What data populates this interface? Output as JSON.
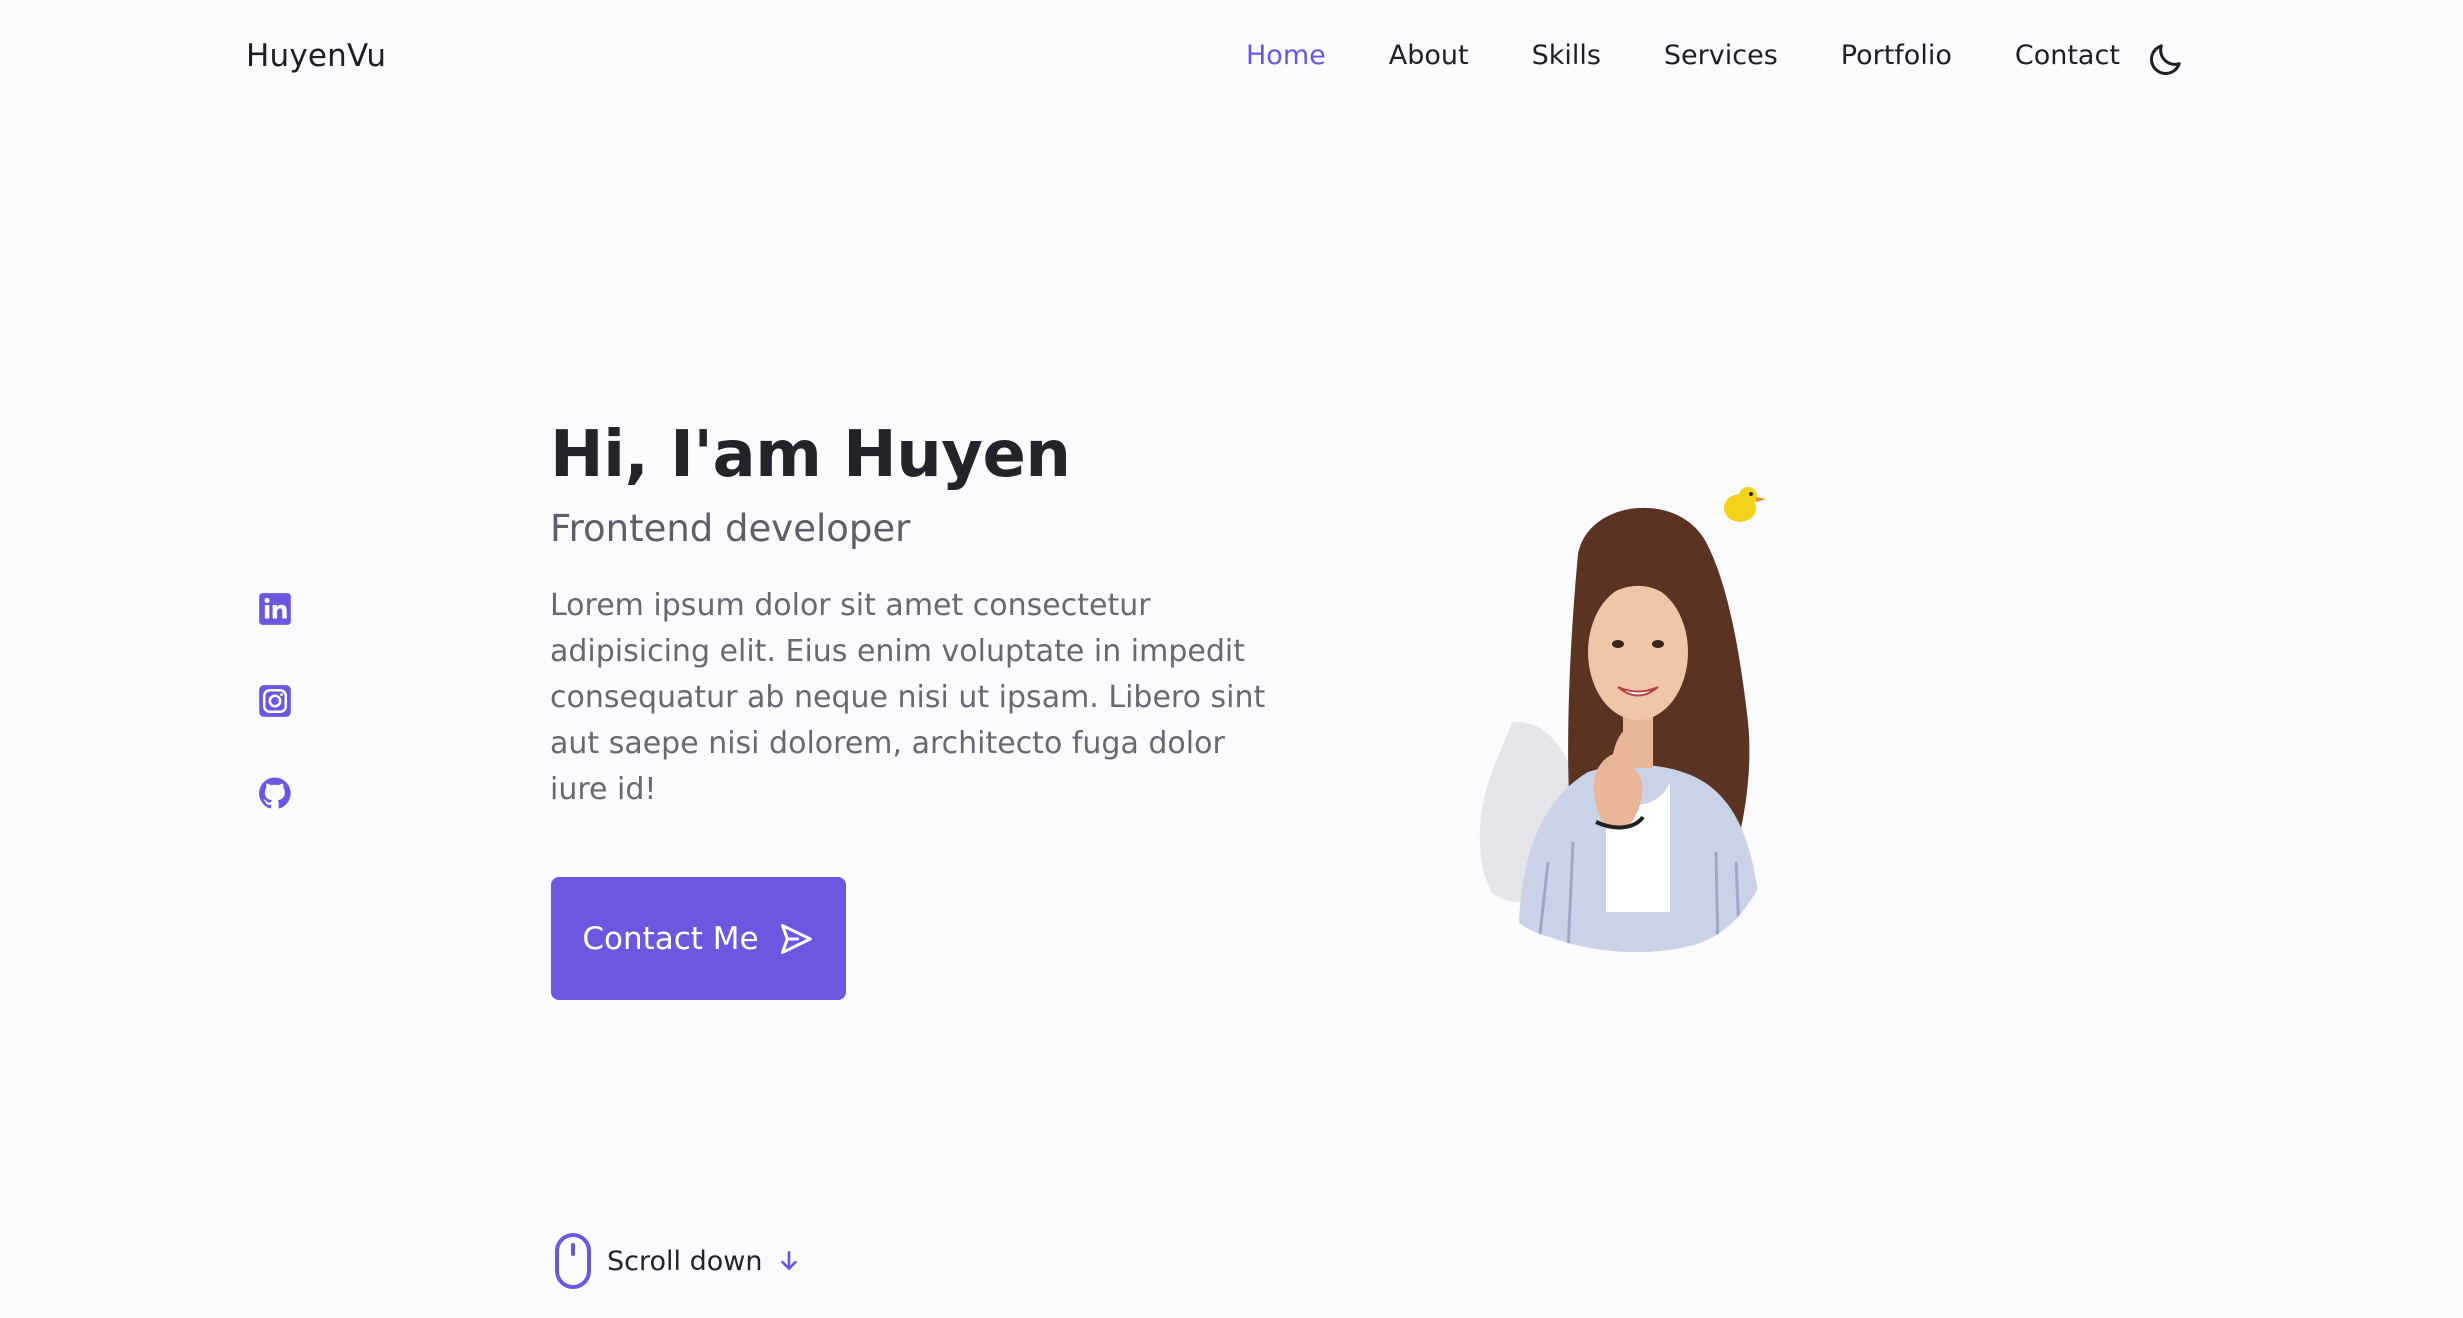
{
  "header": {
    "logo": "HuyenVu",
    "nav": [
      {
        "label": "Home",
        "active": true
      },
      {
        "label": "About",
        "active": false
      },
      {
        "label": "Skills",
        "active": false
      },
      {
        "label": "Services",
        "active": false
      },
      {
        "label": "Portfolio",
        "active": false
      },
      {
        "label": "Contact",
        "active": false
      }
    ],
    "theme_icon": "moon-icon"
  },
  "social": [
    {
      "icon": "linkedin-icon"
    },
    {
      "icon": "instagram-icon"
    },
    {
      "icon": "github-icon"
    }
  ],
  "hero": {
    "title": "Hi, I'am Huyen",
    "subtitle": "Frontend developer",
    "description": "Lorem ipsum dolor sit amet consectetur adipisicing elit. Eius enim voluptate in impedit consequatur ab neque nisi ut ipsam. Libero sint aut saepe nisi dolorem, architecto fuga dolor iure id!",
    "cta_label": "Contact Me",
    "cta_icon": "send-icon"
  },
  "scroll": {
    "label": "Scroll down",
    "icons": [
      "mouse-icon",
      "arrow-down-icon"
    ]
  },
  "colors": {
    "accent": "#6e57e0",
    "background": "#fbfbfe",
    "title": "#24232b",
    "text": "#6a6775"
  }
}
